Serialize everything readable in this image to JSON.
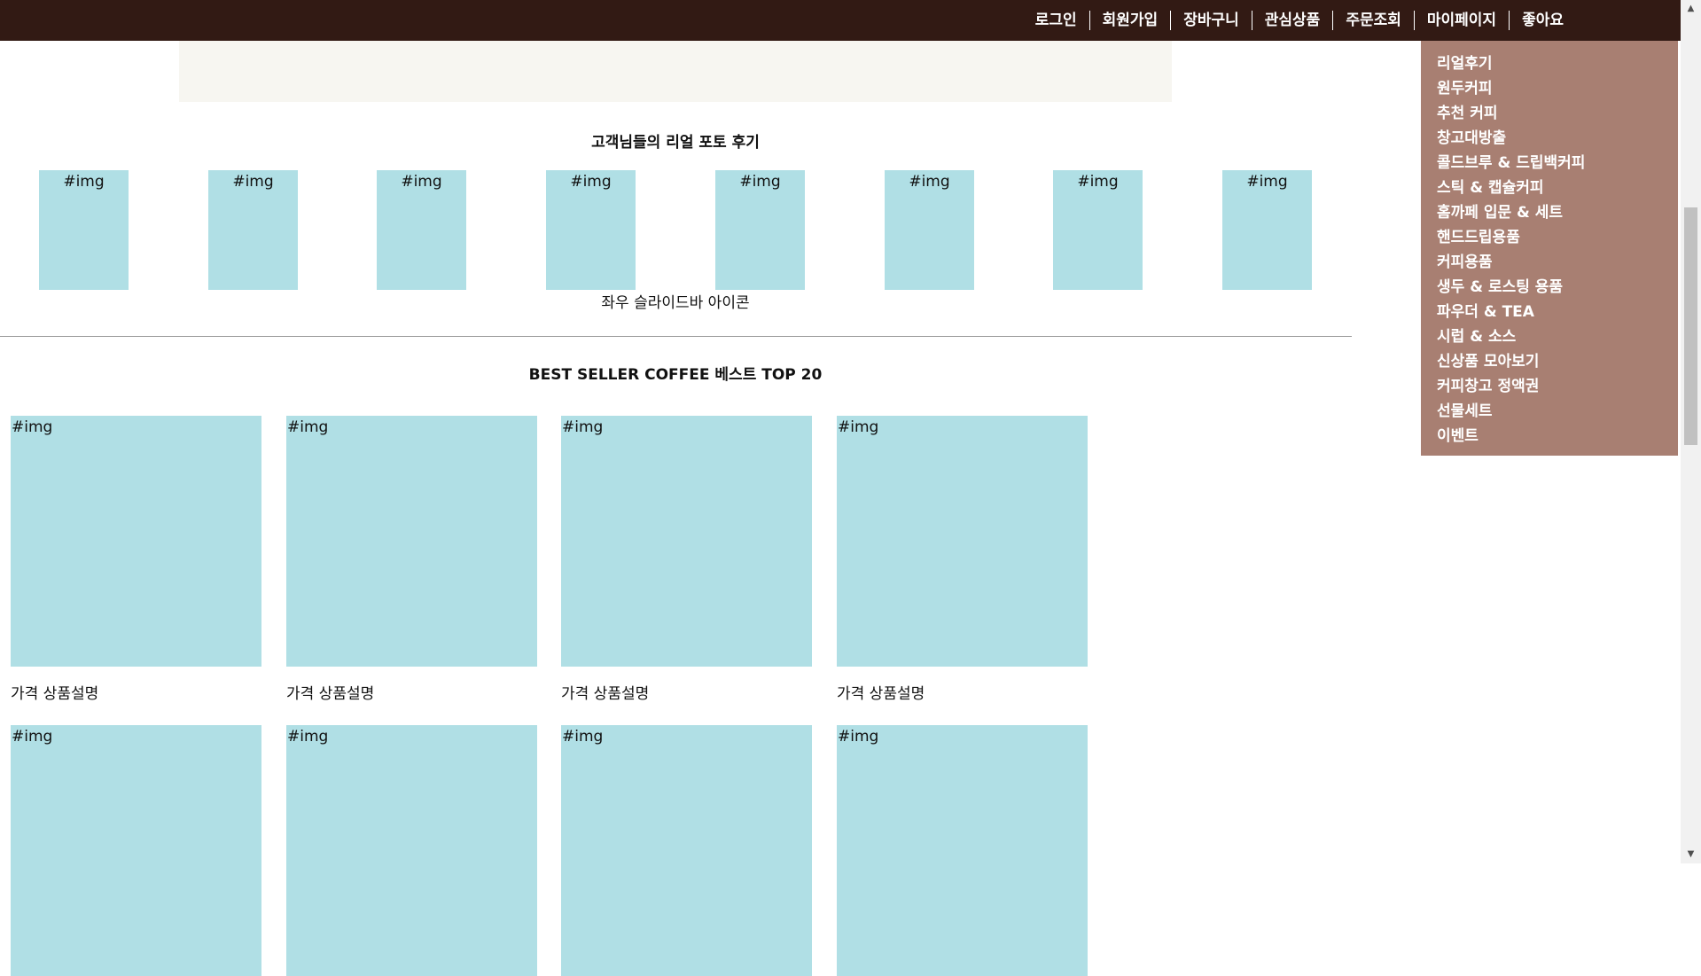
{
  "top_nav": [
    "로그인",
    "회원가입",
    "장바구니",
    "관심상품",
    "주문조회",
    "마이페이지",
    "좋아요"
  ],
  "review_section": {
    "title": "고객님들의 리얼 포토 후기",
    "thumbs": [
      "#img",
      "#img",
      "#img",
      "#img",
      "#img",
      "#img",
      "#img",
      "#img"
    ],
    "slide_label": "좌우 슬라이드바 아이콘"
  },
  "best_section": {
    "title": "BEST SELLER COFFEE 베스트 TOP 20",
    "products": [
      {
        "img": "#img",
        "caption": "가격 상품설명"
      },
      {
        "img": "#img",
        "caption": "가격 상품설명"
      },
      {
        "img": "#img",
        "caption": "가격 상품설명"
      },
      {
        "img": "#img",
        "caption": "가격 상품설명"
      },
      {
        "img": "#img",
        "caption": ""
      },
      {
        "img": "#img",
        "caption": ""
      },
      {
        "img": "#img",
        "caption": ""
      },
      {
        "img": "#img",
        "caption": ""
      }
    ]
  },
  "side_menu": [
    "리얼후기",
    "원두커피",
    "추천 커피",
    "창고대방출",
    "콜드브루 & 드립백커피",
    "스틱 & 캡슐커피",
    "홈까페 입문 & 세트",
    "핸드드립용품",
    "커피용품",
    "생두 & 로스팅 용품",
    "파우더 & TEA",
    "시럽 & 소스",
    "신상품 모아보기",
    "커피창고 정액권",
    "선물세트",
    "이벤트"
  ],
  "scrollbar": {
    "up_icon": "▲",
    "down_icon": "▼"
  },
  "colors": {
    "topbar": "#321a14",
    "side_menu_bg": "#a87f72",
    "placeholder": "#b0dfe5",
    "banner": "#f7f6f1"
  }
}
